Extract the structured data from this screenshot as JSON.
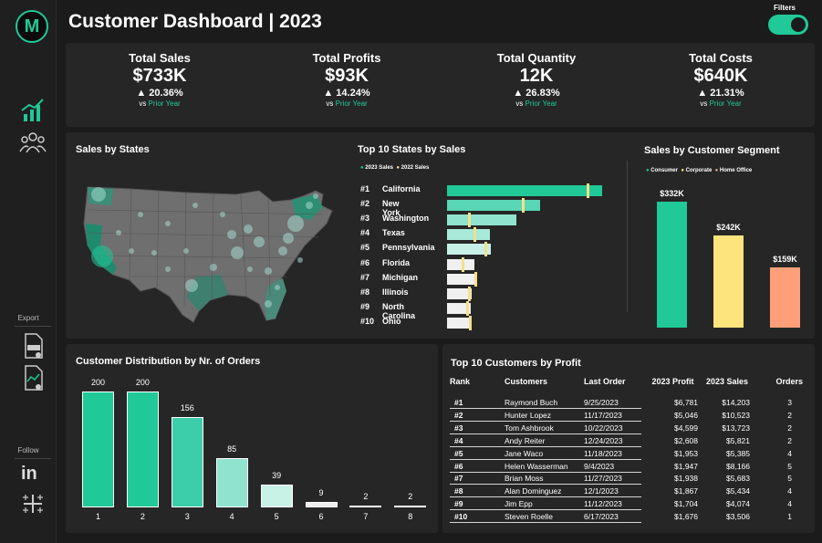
{
  "header": {
    "title": "Customer Dashboard | 2023",
    "filters_label": "Filters",
    "logo_letter": "M"
  },
  "sidebar": {
    "export_label": "Export",
    "follow_label": "Follow",
    "linkedin_label": "in"
  },
  "kpis": [
    {
      "label": "Total Sales",
      "value": "$733K",
      "pct": "▲ 20.36%",
      "vs": "vs",
      "prior": "Prior Year"
    },
    {
      "label": "Total Profits",
      "value": "$93K",
      "pct": "▲ 14.24%",
      "vs": "vs",
      "prior": "Prior Year"
    },
    {
      "label": "Total Quantity",
      "value": "12K",
      "pct": "▲ 26.83%",
      "vs": "vs",
      "prior": "Prior Year"
    },
    {
      "label": "Total Costs",
      "value": "$640K",
      "pct": "▲ 21.31%",
      "vs": "vs",
      "prior": "Prior Year"
    }
  ],
  "map": {
    "title": "Sales by States"
  },
  "top_states": {
    "title": "Top 10 States by Sales",
    "legend": [
      "2023 Sales",
      "2022 Sales"
    ],
    "colors": {
      "y2023": "#20c997",
      "y2022": "#f5e08a"
    },
    "rows": [
      {
        "rank": "#1",
        "name": "California"
      },
      {
        "rank": "#2",
        "name": "New York"
      },
      {
        "rank": "#3",
        "name": "Washington"
      },
      {
        "rank": "#4",
        "name": "Texas"
      },
      {
        "rank": "#5",
        "name": "Pennsylvania"
      },
      {
        "rank": "#6",
        "name": "Florida"
      },
      {
        "rank": "#7",
        "name": "Michigan"
      },
      {
        "rank": "#8",
        "name": "Illinois"
      },
      {
        "rank": "#9",
        "name": "North Carolina"
      },
      {
        "rank": "#10",
        "name": "Ohio"
      }
    ]
  },
  "segment": {
    "title": "Sales by Customer Segment",
    "legend": [
      "Consumer",
      "Corporate",
      "Home Office"
    ]
  },
  "distribution": {
    "title": "Customer Distribution by Nr. of Orders"
  },
  "customers": {
    "title": "Top 10 Customers by Profit",
    "headers": [
      "Rank",
      "Customers",
      "Last Order",
      "2023 Profit",
      "2023 Sales",
      "Orders"
    ],
    "rows": [
      [
        "#1",
        "Raymond Buch",
        "9/25/2023",
        "$6,781",
        "$14,203",
        "3"
      ],
      [
        "#2",
        "Hunter Lopez",
        "11/17/2023",
        "$5,046",
        "$10,523",
        "2"
      ],
      [
        "#3",
        "Tom Ashbrook",
        "10/22/2023",
        "$4,599",
        "$13,723",
        "2"
      ],
      [
        "#4",
        "Andy Reiter",
        "12/24/2023",
        "$2,608",
        "$5,821",
        "2"
      ],
      [
        "#5",
        "Jane Waco",
        "11/18/2023",
        "$1,953",
        "$5,385",
        "4"
      ],
      [
        "#6",
        "Helen Wasserman",
        "9/4/2023",
        "$1,947",
        "$8,166",
        "5"
      ],
      [
        "#7",
        "Brian Moss",
        "11/27/2023",
        "$1,938",
        "$5,683",
        "5"
      ],
      [
        "#8",
        "Alan Dominguez",
        "12/1/2023",
        "$1,867",
        "$5,434",
        "4"
      ],
      [
        "#9",
        "Jim Epp",
        "11/12/2023",
        "$1,704",
        "$4,074",
        "4"
      ],
      [
        "#10",
        "Steven Roelle",
        "6/17/2023",
        "$1,676",
        "$3,506",
        "1"
      ]
    ]
  },
  "chart_data": [
    {
      "type": "bar",
      "orientation": "horizontal",
      "categories": [
        "California",
        "New York",
        "Washington",
        "Texas",
        "Pennsylvania",
        "Florida",
        "Michigan",
        "Illinois",
        "North Carolina",
        "Ohio"
      ],
      "series": [
        {
          "name": "2023 Sales",
          "values": [
            146,
            88,
            65,
            40,
            41,
            26,
            28,
            23,
            22,
            22
          ],
          "color": "#20c997"
        },
        {
          "name": "2022 Sales",
          "values": [
            131,
            70,
            20,
            25,
            35,
            14,
            26,
            20,
            18,
            21
          ],
          "color": "#f5e08a"
        }
      ]
    },
    {
      "type": "bar",
      "categories": [
        "Consumer",
        "Corporate",
        "Home Office"
      ],
      "values": [
        332,
        242,
        159
      ],
      "labels": [
        "$332K",
        "$242K",
        "$159K"
      ],
      "colors": [
        "#20c997",
        "#fde47d",
        "#ff9f7a"
      ]
    },
    {
      "type": "bar",
      "categories": [
        "1",
        "2",
        "3",
        "4",
        "5",
        "6",
        "7",
        "8"
      ],
      "values": [
        200,
        200,
        156,
        85,
        39,
        9,
        2,
        2
      ],
      "colors": [
        "#20c997",
        "#20c997",
        "#3ccdaa",
        "#8fe3cf",
        "#c9f2e7",
        "#f0f0f0",
        "#f0f0f0",
        "#f0f0f0"
      ]
    }
  ]
}
